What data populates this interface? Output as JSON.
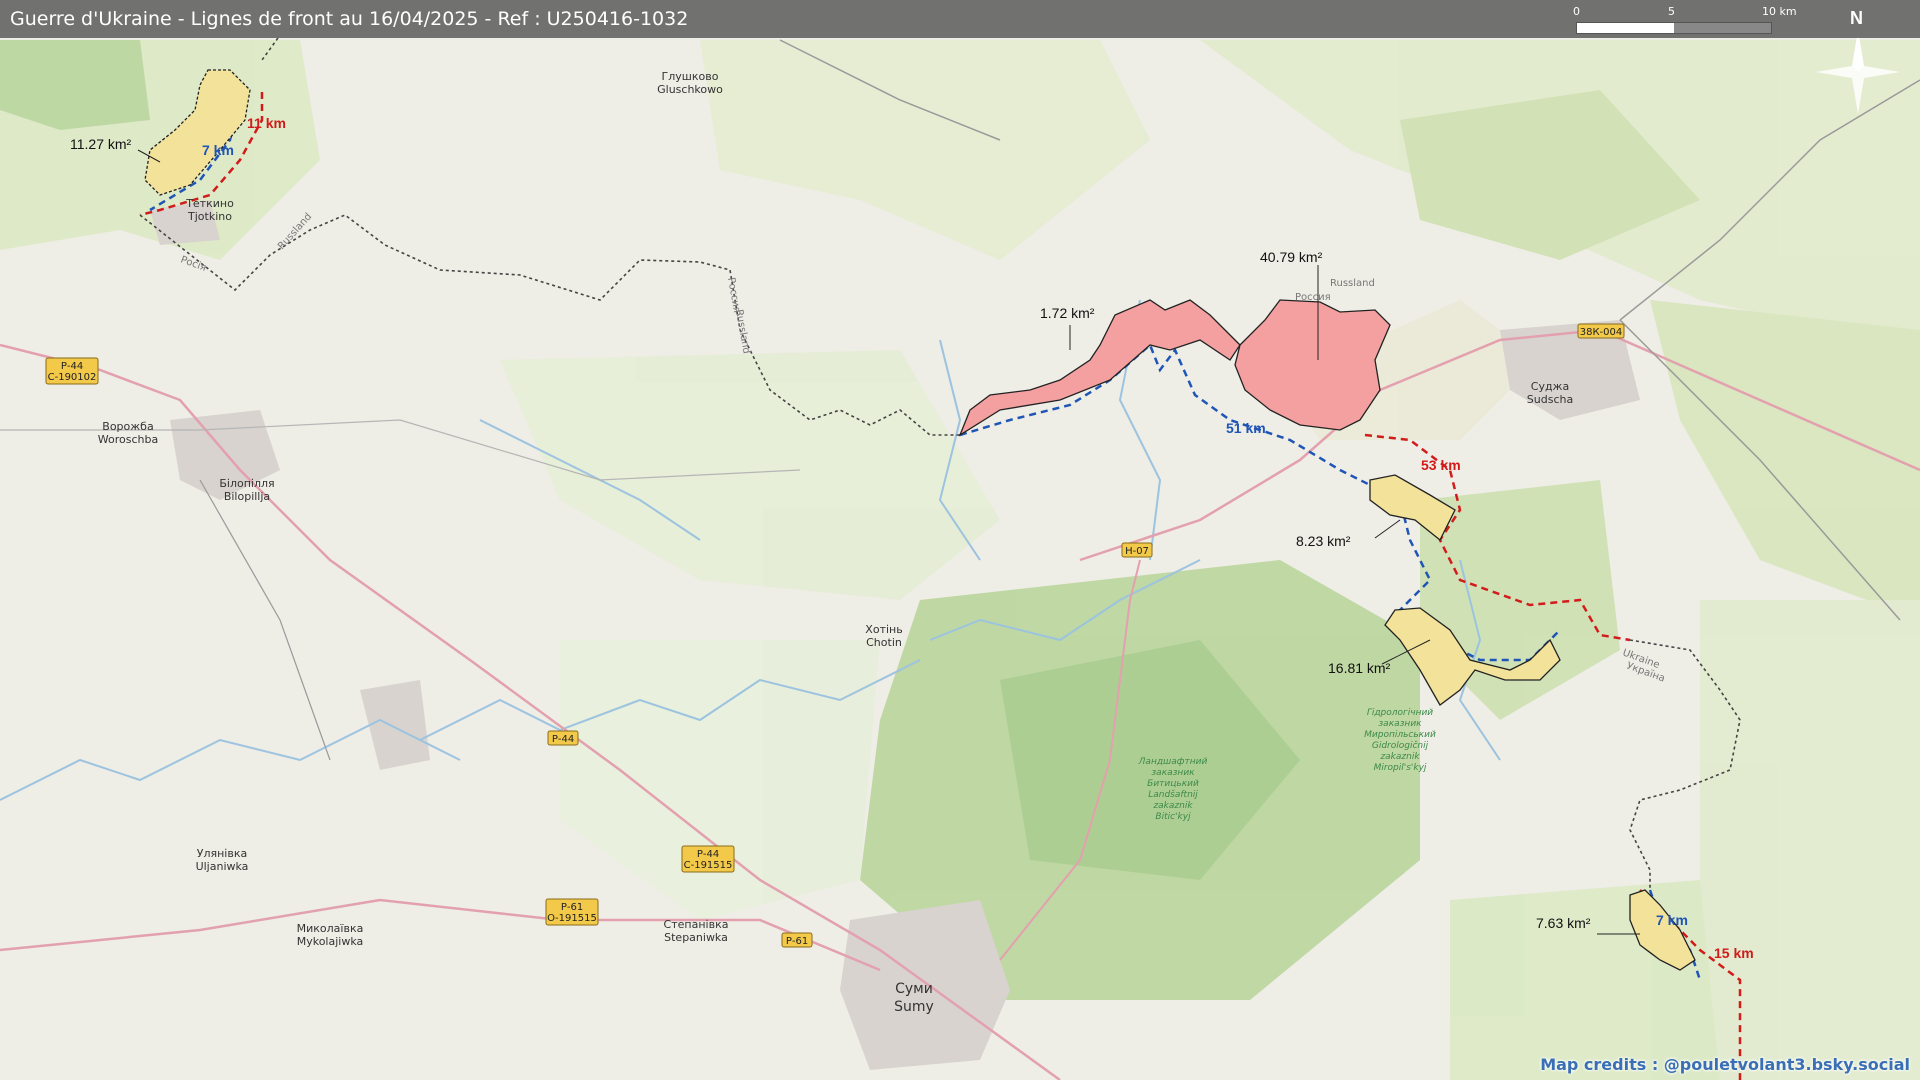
{
  "title": "Guerre d'Ukraine - Lignes de front au 16/04/2025 - Ref : U250416-1032",
  "scale": {
    "labels": [
      "0",
      "5",
      "10 km"
    ]
  },
  "north": "N",
  "credits": "Map credits : @pouletvolant3.bsky.social",
  "places": [
    {
      "id": "glushkovo",
      "l1": "Глушково",
      "l2": "Gluschkowo"
    },
    {
      "id": "tetkino",
      "l1": "Теткино",
      "l2": "Tjotkino"
    },
    {
      "id": "vorozhba",
      "l1": "Ворожба",
      "l2": "Woroschba"
    },
    {
      "id": "bilopillia",
      "l1": "Білопілля",
      "l2": "Bilopillja"
    },
    {
      "id": "sudzha",
      "l1": "Суджа",
      "l2": "Sudscha"
    },
    {
      "id": "khotin",
      "l1": "Хотінь",
      "l2": "Chotin"
    },
    {
      "id": "ulianivka",
      "l1": "Улянівка",
      "l2": "Uljaniwka"
    },
    {
      "id": "stepanivka",
      "l1": "Степанівка",
      "l2": "Stepaniwka"
    },
    {
      "id": "mykolaivka",
      "l1": "Миколаївка",
      "l2": "Mykolajiwka"
    },
    {
      "id": "sumy",
      "l1": "Суми",
      "l2": "Sumy"
    }
  ],
  "roads": [
    {
      "id": "p44a",
      "l1": "Р-44",
      "l2": "С-190102"
    },
    {
      "id": "p44b",
      "l1": "Р-44",
      "l2": ""
    },
    {
      "id": "p44c",
      "l1": "Р-44",
      "l2": "С-191515"
    },
    {
      "id": "p61a",
      "l1": "Р-61",
      "l2": "О-191515"
    },
    {
      "id": "p61b",
      "l1": "Р-61",
      "l2": ""
    },
    {
      "id": "h07",
      "l1": "Н-07",
      "l2": ""
    },
    {
      "id": "k004",
      "l1": "38К-004",
      "l2": ""
    }
  ],
  "areas": [
    {
      "id": "a1",
      "label": "11.27 km²",
      "color": "#f3e29a"
    },
    {
      "id": "a2",
      "label": "1.72 km²",
      "color": "#f4a0a0"
    },
    {
      "id": "a3",
      "label": "40.79 km²",
      "color": "#f4a0a0"
    },
    {
      "id": "a4",
      "label": "8.23 km²",
      "color": "#f3e29a"
    },
    {
      "id": "a5",
      "label": "16.81 km²",
      "color": "#f3e29a"
    },
    {
      "id": "a6",
      "label": "7.63 km²",
      "color": "#f3e29a"
    }
  ],
  "distances": [
    {
      "id": "d1",
      "label": "11 km",
      "color": "#d21b1b"
    },
    {
      "id": "d2",
      "label": "7 km",
      "color": "#1f55b6"
    },
    {
      "id": "d3",
      "label": "51 km",
      "color": "#1f55b6"
    },
    {
      "id": "d4",
      "label": "53 km",
      "color": "#d21b1b"
    },
    {
      "id": "d5",
      "label": "7 km",
      "color": "#1f55b6"
    },
    {
      "id": "d6",
      "label": "15 km",
      "color": "#d21b1b"
    }
  ],
  "border_labels": [
    "Russland",
    "Россия",
    "Russland",
    "Росія",
    "Russland",
    "Россия",
    "Україна",
    "Ukraine"
  ],
  "reserve_labels": {
    "a": [
      "Ландшафтний",
      "заказник",
      "Битицький",
      "Landšaftnij",
      "zakaznik",
      "Bitic'kyj"
    ],
    "b": [
      "Гідрологічний",
      "заказник",
      "Миропільський",
      "Gidrologičnij",
      "zakaznik",
      "Miropil's'kyj"
    ]
  }
}
